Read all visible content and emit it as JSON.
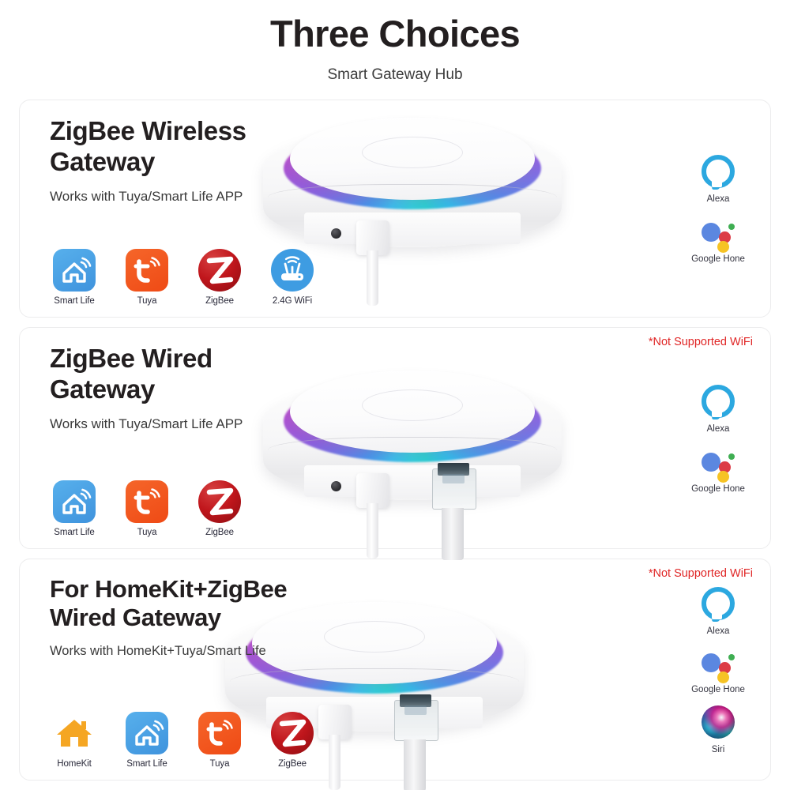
{
  "header": {
    "title": "Three Choices",
    "subtitle": "Smart Gateway Hub"
  },
  "colors": {
    "title": "#231f20",
    "note_red": "#e02626",
    "smart_life": "#4aa0e6",
    "tuya": "#f05423",
    "zigbee": "#c0161c",
    "wifi24": "#3e9ce2",
    "homekit": "#f5a623",
    "alexa": "#2ca8e0",
    "card_border": "#ececed"
  },
  "cards": [
    {
      "id": "card-1",
      "title_line1": "ZigBee Wireless",
      "title_line2": "Gateway",
      "subtitle": "Works with Tuya/Smart Life APP",
      "note": "",
      "device": {
        "type": "hub-usb",
        "has_ethernet": false,
        "ring": "rgb-light-ring"
      },
      "apps": [
        {
          "icon": "smart-life-icon",
          "label": "Smart Life"
        },
        {
          "icon": "tuya-icon",
          "label": "Tuya"
        },
        {
          "icon": "zigbee-icon",
          "label": "ZigBee"
        },
        {
          "icon": "wifi-24g-icon",
          "label": "2.4G WiFi"
        }
      ],
      "assistants": [
        {
          "icon": "alexa-icon",
          "label": "Alexa"
        },
        {
          "icon": "google-home-icon",
          "label": "Google Hone"
        }
      ]
    },
    {
      "id": "card-2",
      "title_line1": "ZigBee Wired",
      "title_line2": "Gateway",
      "subtitle": "Works with Tuya/Smart Life APP",
      "note": "*Not Supported WiFi",
      "device": {
        "type": "hub-usb-ethernet",
        "has_ethernet": true,
        "ring": "rgb-light-ring"
      },
      "apps": [
        {
          "icon": "smart-life-icon",
          "label": "Smart Life"
        },
        {
          "icon": "tuya-icon",
          "label": "Tuya"
        },
        {
          "icon": "zigbee-icon",
          "label": "ZigBee"
        }
      ],
      "assistants": [
        {
          "icon": "alexa-icon",
          "label": "Alexa"
        },
        {
          "icon": "google-home-icon",
          "label": "Google Hone"
        }
      ]
    },
    {
      "id": "card-3",
      "title_line1": "For HomeKit+ZigBee",
      "title_line2": "Wired Gateway",
      "subtitle": "Works with HomeKit+Tuya/Smart Life",
      "note": "*Not Supported WiFi",
      "device": {
        "type": "hub-usb-ethernet",
        "has_ethernet": true,
        "ring": "rgb-light-ring"
      },
      "apps": [
        {
          "icon": "homekit-icon",
          "label": "HomeKit"
        },
        {
          "icon": "smart-life-icon",
          "label": "Smart Life"
        },
        {
          "icon": "tuya-icon",
          "label": "Tuya"
        },
        {
          "icon": "zigbee-icon",
          "label": "ZigBee"
        }
      ],
      "assistants": [
        {
          "icon": "alexa-icon",
          "label": "Alexa"
        },
        {
          "icon": "google-home-icon",
          "label": "Google Hone"
        },
        {
          "icon": "siri-icon",
          "label": "Siri"
        }
      ]
    }
  ]
}
